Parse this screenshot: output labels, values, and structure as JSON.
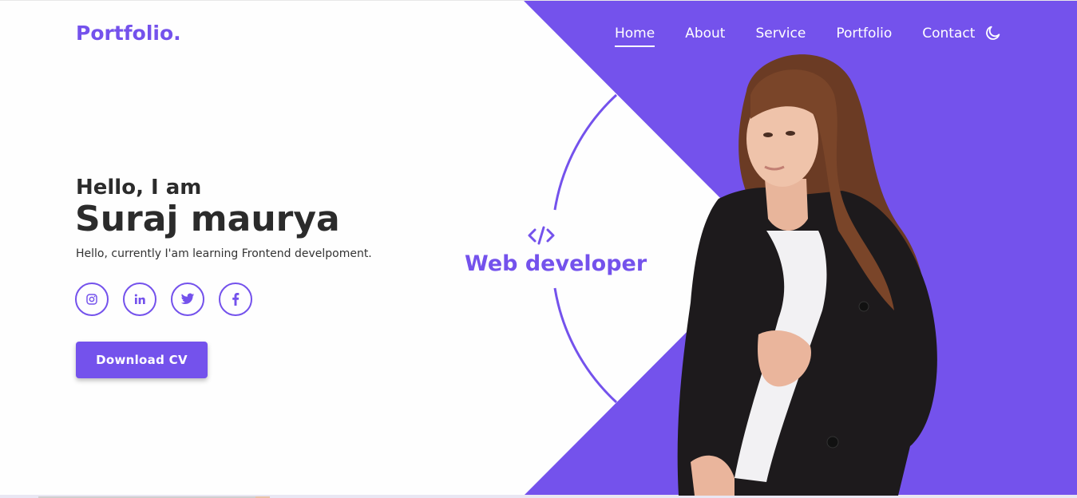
{
  "brand": {
    "logo": "Portfolio."
  },
  "nav": {
    "items": [
      {
        "label": "Home",
        "active": true
      },
      {
        "label": "About",
        "active": false
      },
      {
        "label": "Service",
        "active": false
      },
      {
        "label": "Portfolio",
        "active": false
      },
      {
        "label": "Contact",
        "active": false
      }
    ],
    "theme_toggle_icon": "moon-icon"
  },
  "hero": {
    "greeting": "Hello, I am",
    "name": "Suraj maurya",
    "tagline": "Hello, currently I'am learning Frontend develpoment.",
    "socials": [
      {
        "icon": "instagram-icon"
      },
      {
        "icon": "linkedin-icon"
      },
      {
        "icon": "twitter-icon"
      },
      {
        "icon": "facebook-icon"
      }
    ],
    "cta_label": "Download CV",
    "role_icon": "code-icon",
    "role": "Web developer"
  },
  "colors": {
    "accent": "#7452ec",
    "text_dark": "#2b2b2b",
    "background": "#fefefe"
  }
}
